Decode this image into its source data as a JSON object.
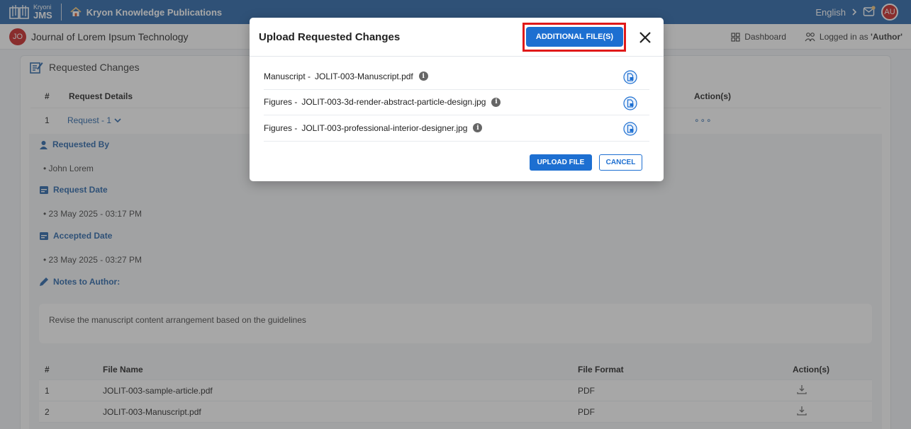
{
  "topbar": {
    "logo_small": "Kryoni",
    "logo_big": "JMS",
    "publication": "Kryon Knowledge Publications",
    "language": "English",
    "user_initials": "AU"
  },
  "subbar": {
    "journal_initials": "JO",
    "journal_title": "Journal of Lorem Ipsum Technology",
    "dashboard": "Dashboard",
    "logged_in_prefix": "Logged in as ",
    "logged_in_role": "'Author'"
  },
  "card": {
    "title": "Requested Changes",
    "columns": [
      "#",
      "Request Details",
      "Action(s)"
    ],
    "request_no": "1",
    "request_label": "Request - 1",
    "requested_by_label": "Requested By",
    "requested_by": "John Lorem",
    "request_date_label": "Request Date",
    "request_date": "23 May 2025 - 03:17 PM",
    "accepted_date_label": "Accepted Date",
    "accepted_date": "23 May 2025 - 03:27 PM",
    "notes_label": "Notes to Author:",
    "notes": "Revise the manuscript content arrangement based on the guidelines",
    "files_columns": [
      "#",
      "File Name",
      "File Format",
      "Action(s)"
    ],
    "files": [
      {
        "no": "1",
        "name": "JOLIT-003-sample-article.pdf",
        "format": "PDF"
      },
      {
        "no": "2",
        "name": "JOLIT-003-Manuscript.pdf",
        "format": "PDF"
      }
    ]
  },
  "modal": {
    "title": "Upload Requested Changes",
    "additional_button": "ADDITIONAL FILE(S)",
    "rows": [
      {
        "label": "Manuscript -",
        "file": "JOLIT-003-Manuscript.pdf"
      },
      {
        "label": "Figures -",
        "file": "JOLIT-003-3d-render-abstract-particle-design.jpg"
      },
      {
        "label": "Figures -",
        "file": "JOLIT-003-professional-interior-designer.jpg"
      }
    ],
    "upload_button": "UPLOAD FILE",
    "cancel_button": "CANCEL"
  },
  "colors": {
    "brand": "#2563a8",
    "button": "#1d6fd1",
    "highlight": "#e01919",
    "avatar": "#c92121"
  },
  "icons": [
    "book-logo-icon",
    "home-icon",
    "chevron-right-icon",
    "mail-icon",
    "grid-icon",
    "user-network-icon",
    "edit-note-icon",
    "chevron-down-icon",
    "more-icon",
    "user-icon",
    "calendar-icon",
    "pencil-icon",
    "download-icon",
    "info-icon",
    "file-upload-icon",
    "close-icon"
  ]
}
